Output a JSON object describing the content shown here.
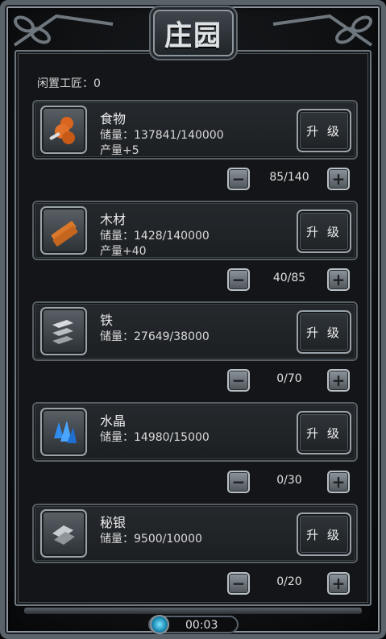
{
  "header": {
    "title": "庄园"
  },
  "idle_workers": {
    "label": "闲置工匠：0"
  },
  "resources": [
    {
      "name": "食物",
      "stock": "储量：137841/140000",
      "production": "产量+5",
      "upgrade": "升 级",
      "workers": "85/140",
      "icon": "food-icon"
    },
    {
      "name": "木材",
      "stock": "储量：1428/140000",
      "production": "产量+40",
      "upgrade": "升 级",
      "workers": "40/85",
      "icon": "wood-icon"
    },
    {
      "name": "铁",
      "stock": "储量：27649/38000",
      "production": "",
      "upgrade": "升 级",
      "workers": "0/70",
      "icon": "iron-icon"
    },
    {
      "name": "水晶",
      "stock": "储量：14980/15000",
      "production": "",
      "upgrade": "升 级",
      "workers": "0/30",
      "icon": "crystal-icon"
    },
    {
      "name": "秘银",
      "stock": "储量：9500/10000",
      "production": "",
      "upgrade": "升 级",
      "workers": "0/20",
      "icon": "mithril-icon"
    }
  ],
  "stepper": {
    "minus_icon": "minus-icon",
    "plus_icon": "plus-icon"
  },
  "timer": {
    "value": "00:03",
    "icon": "timer-orb-icon"
  },
  "colors": {
    "frame": "#5b636a",
    "panel": "#131518",
    "text": "#e6e6e6"
  }
}
